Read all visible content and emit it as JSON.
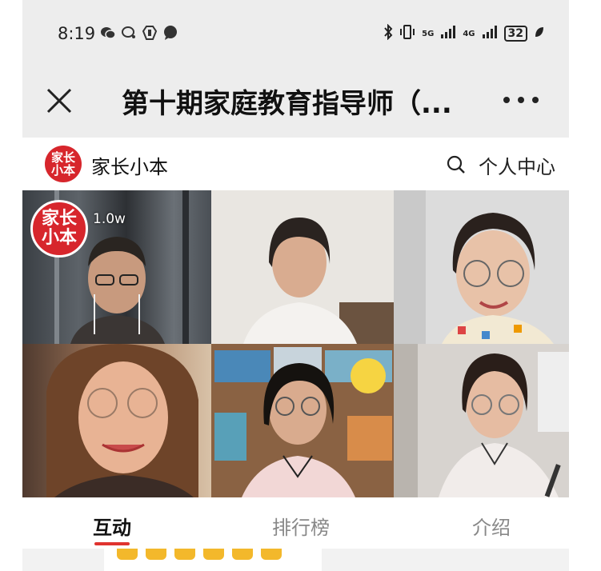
{
  "status_bar": {
    "time": "8:19",
    "battery": "32",
    "net_5g": "5G",
    "net_4g": "4G"
  },
  "title_bar": {
    "title": "第十期家庭教育指导师（..."
  },
  "header": {
    "brand_name": "家长小本",
    "logo_text": "家长小本",
    "user_center": "个人中心"
  },
  "live": {
    "view_count": "1.0w",
    "badge_logo_text": "家长小本"
  },
  "tabs": [
    {
      "label": "互动"
    },
    {
      "label": "排行榜"
    },
    {
      "label": "介绍"
    }
  ],
  "colors": {
    "accent_red": "#d7262c",
    "bar_gray": "#ededed"
  }
}
